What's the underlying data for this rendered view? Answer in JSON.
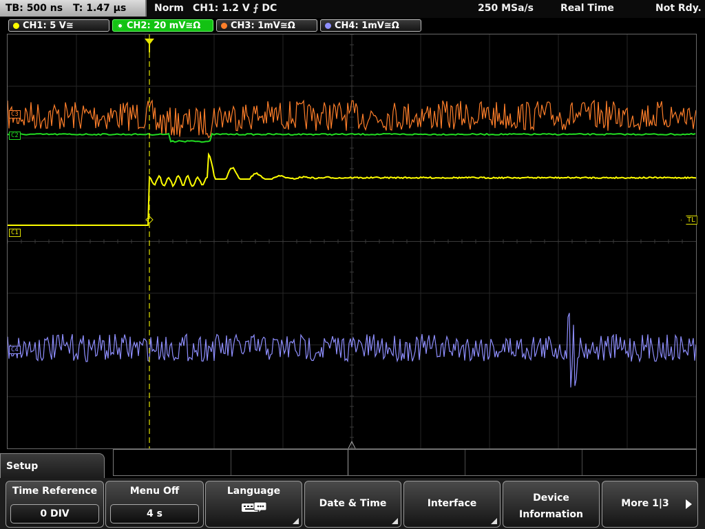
{
  "topbar": {
    "timebase": "TB: 500 ns",
    "trigger_time": "T: 1.47 µs",
    "mode": "Norm",
    "trigger_setting": "CH1: 1.2 V ⨍ DC",
    "sample_rate": "250 MSa/s",
    "acq_mode": "Real Time",
    "state": "Not Rdy."
  },
  "channels": [
    {
      "label": "CH1: 5 V≅",
      "color": "#ffff00"
    },
    {
      "label": "CH2: 20 mV≅Ω",
      "color": "#22dd22"
    },
    {
      "label": "CH3: 1mV≅Ω",
      "color": "#ff7f2a"
    },
    {
      "label": "CH4: 1mV≅Ω",
      "color": "#8f8fff"
    }
  ],
  "screen": {
    "markers": {
      "c3": "C3",
      "c2": "C2",
      "c1": "C1",
      "c4": "C4",
      "tl": "TL"
    }
  },
  "menu": {
    "title": "Setup",
    "keys": [
      {
        "label": "Time Reference",
        "value": "0 DIV"
      },
      {
        "label": "Menu Off",
        "value": "4 s"
      },
      {
        "label": "Language",
        "icon": "keyboard-icon"
      },
      {
        "label": "Date & Time"
      },
      {
        "label": "Interface"
      },
      {
        "label_line1": "Device",
        "label_line2": "Information"
      },
      {
        "label": "More 1|3"
      }
    ]
  }
}
